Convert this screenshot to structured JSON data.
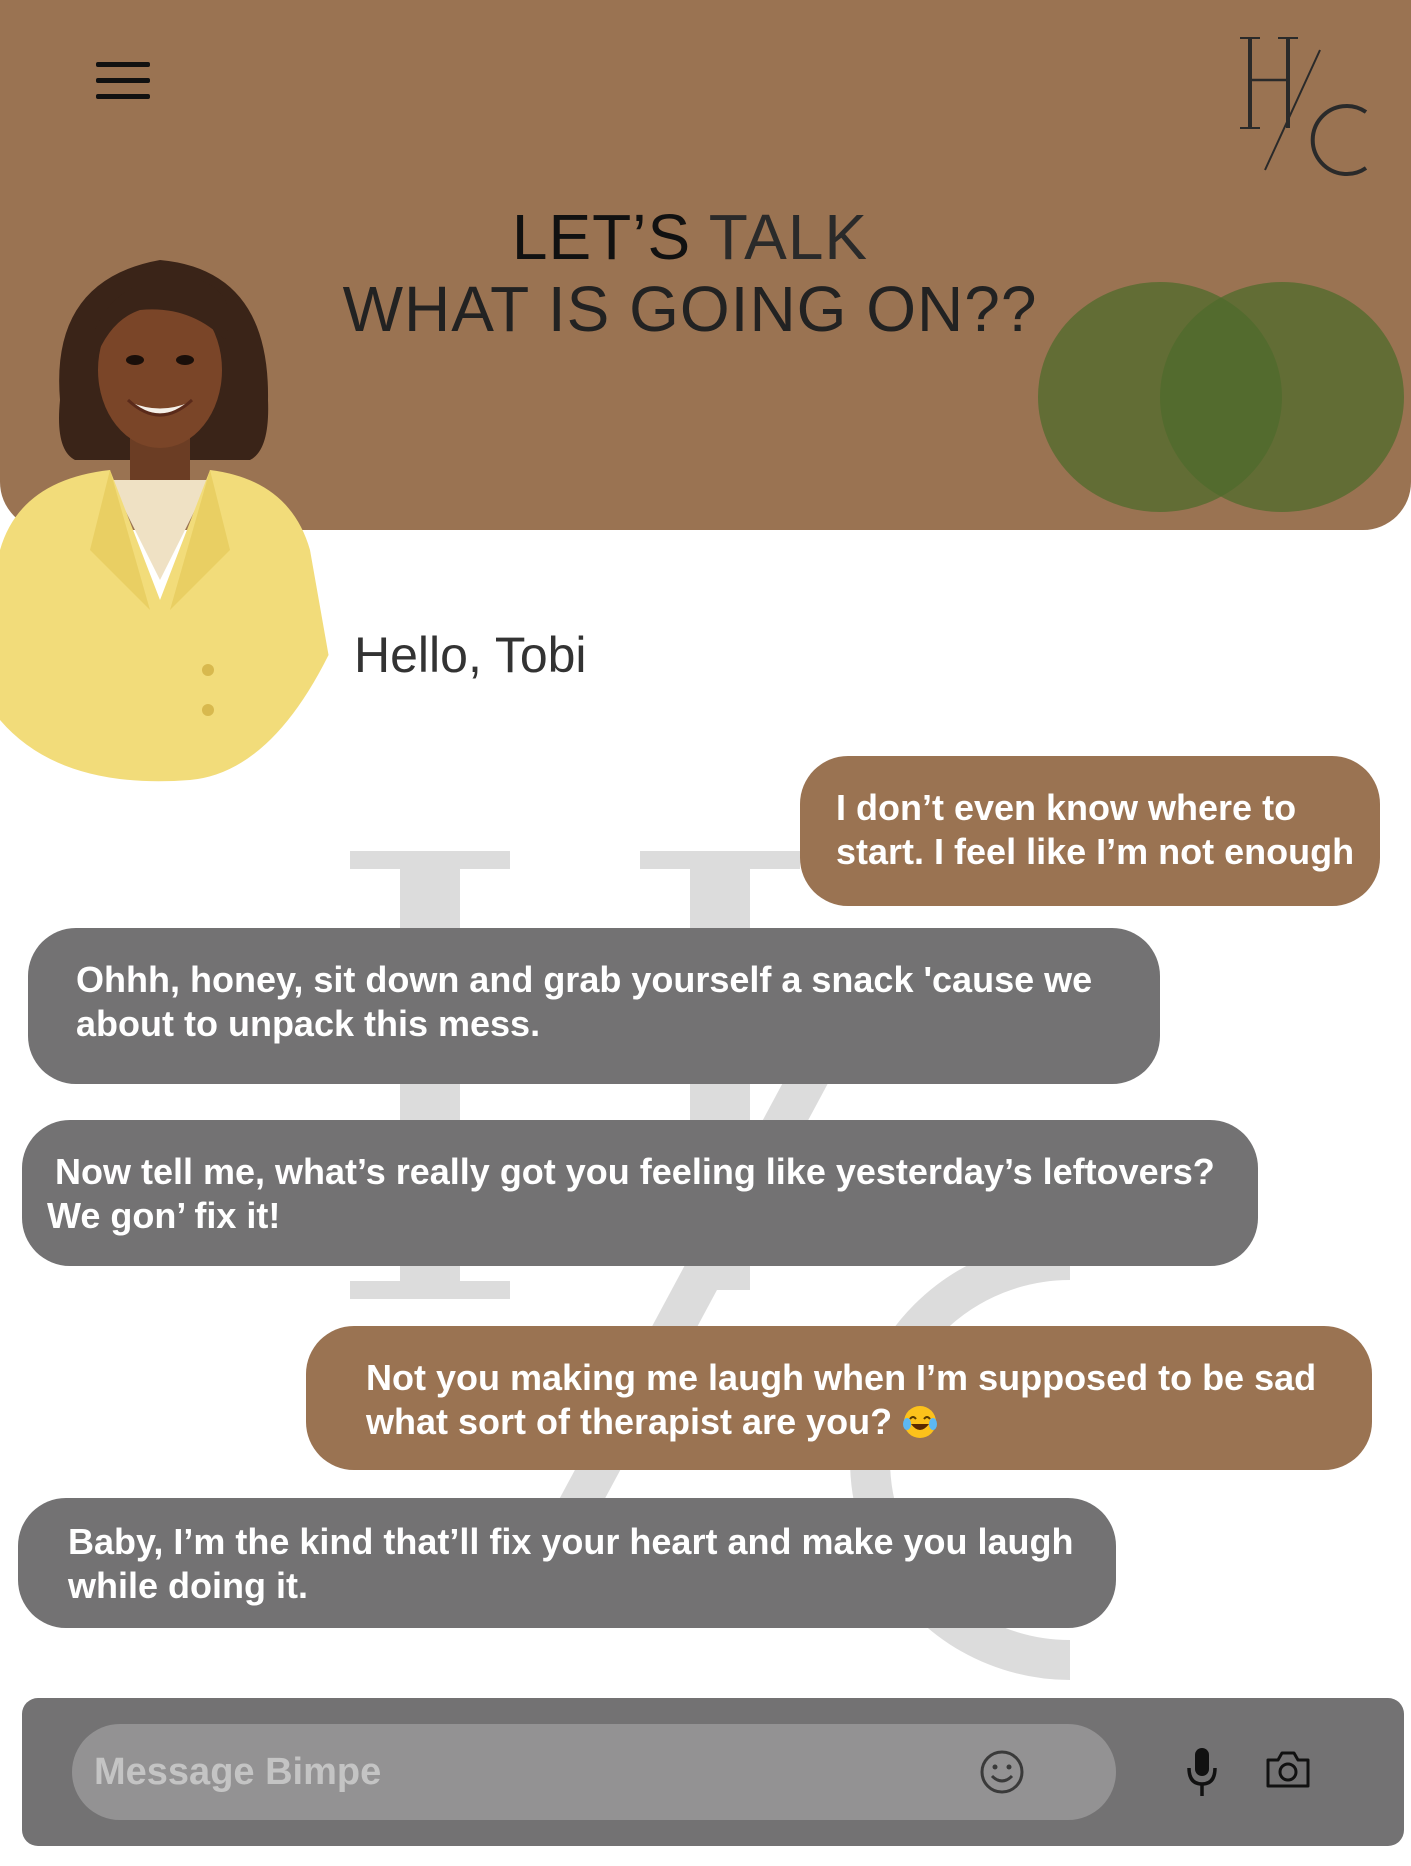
{
  "header": {
    "title_line1_bold": "LET’S",
    "title_line1_light": " TALK",
    "title_line2": "WHAT IS GOING ON??",
    "logo_text": "H/C",
    "menu_icon": "hamburger-menu-icon",
    "brand_color": "#9a7352",
    "accent_green": "#4f6b2c"
  },
  "greeting": "Hello, Tobi",
  "messages": [
    {
      "sender": "user",
      "line1": "I don’t even know where to",
      "line2": "start. I feel like I’m not enough"
    },
    {
      "sender": "bot",
      "line1": "Ohhh, honey, sit down and grab yourself a snack 'cause we",
      "line2": "about to unpack this mess."
    },
    {
      "sender": "bot",
      "line1": "Now tell me, what’s really got you feeling like yesterday’s leftovers?",
      "line2": "We gon’ fix it!"
    },
    {
      "sender": "user",
      "line1": "Not you making me laugh when I’m supposed to be sad",
      "line2": "what sort of therapist are you? ",
      "emoji": "face-with-tears-of-joy-icon"
    },
    {
      "sender": "bot",
      "line1": "Baby, I’m the kind that’ll fix your heart and make you laugh",
      "line2": "while doing it."
    }
  ],
  "composer": {
    "placeholder": "Message Bimpe",
    "value": "",
    "icons": [
      "smiley-icon",
      "microphone-icon",
      "camera-icon"
    ],
    "bot_bubble_color": "#737273"
  }
}
